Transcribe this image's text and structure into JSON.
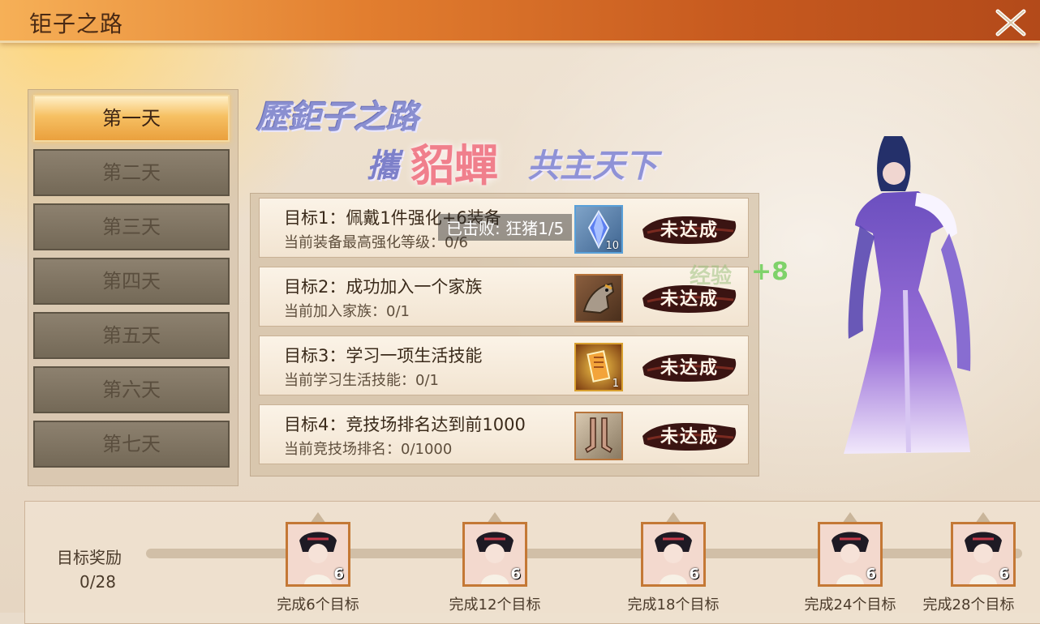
{
  "header": {
    "title": "钜子之路",
    "close_icon": "close-x-icon"
  },
  "days": [
    {
      "label": "第一天",
      "active": true
    },
    {
      "label": "第二天",
      "active": false
    },
    {
      "label": "第三天",
      "active": false
    },
    {
      "label": "第四天",
      "active": false
    },
    {
      "label": "第五天",
      "active": false
    },
    {
      "label": "第六天",
      "active": false
    },
    {
      "label": "第七天",
      "active": false
    }
  ],
  "slogan": {
    "line1": "歷鉅子之路",
    "line2_left": "攜",
    "line2_mid": "貂蟬",
    "line2_right": "共主天下"
  },
  "goals": [
    {
      "title": "目标1：佩戴1件强化+6装备",
      "progress": "当前装备最高强化等级：0/6",
      "item_icon": "crystal-icon",
      "item_count": "10",
      "status": "未达成"
    },
    {
      "title": "目标2：成功加入一个家族",
      "progress": "当前加入家族：0/1",
      "item_icon": "horse-icon",
      "item_count": "",
      "status": "未达成"
    },
    {
      "title": "目标3：学习一项生活技能",
      "progress": "当前学习生活技能：0/1",
      "item_icon": "skill-book-icon",
      "item_count": "1",
      "status": "未达成"
    },
    {
      "title": "目标4：竞技场排名达到前1000",
      "progress": "当前竞技场排名：0/1000",
      "item_icon": "boots-icon",
      "item_count": "",
      "status": "未达成"
    }
  ],
  "tooltip": "已击败: 狂猪1/5",
  "float_text": {
    "main": "+8",
    "faint": "经验"
  },
  "rewards": {
    "label": "目标奖励",
    "count": "0/28",
    "progress": 0,
    "milestones": [
      {
        "caption": "完成6个目标",
        "qty": "6"
      },
      {
        "caption": "完成12个目标",
        "qty": "6"
      },
      {
        "caption": "完成18个目标",
        "qty": "6"
      },
      {
        "caption": "完成24个目标",
        "qty": "6"
      },
      {
        "caption": "完成28个目标",
        "qty": "6"
      }
    ]
  },
  "colors": {
    "accent": "#eaa03d",
    "header": "#c75a1f",
    "status_red": "#8c1d18"
  }
}
